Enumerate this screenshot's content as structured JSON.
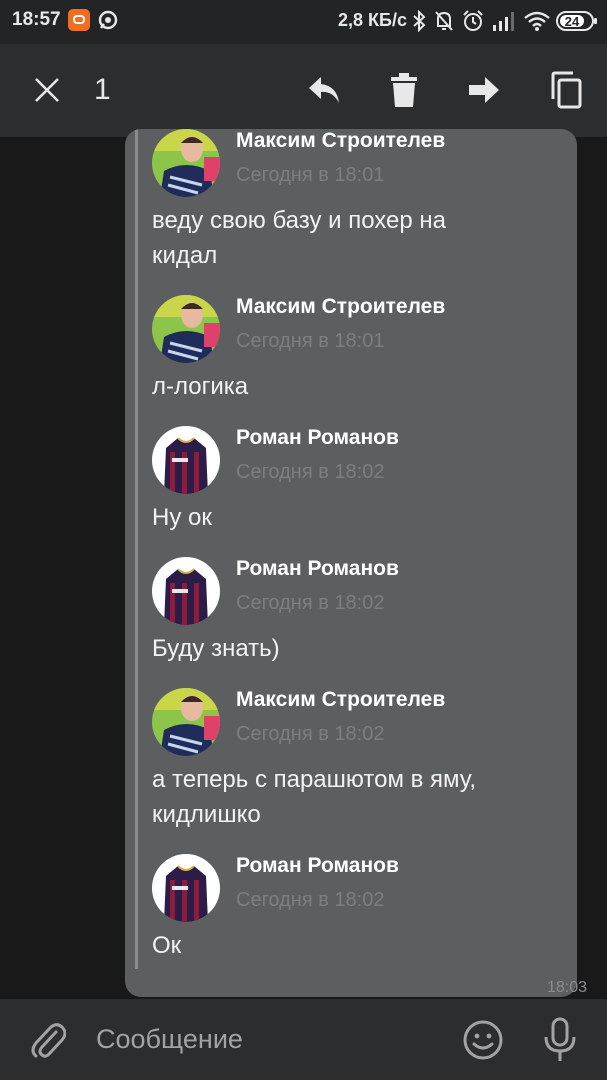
{
  "status_bar": {
    "time": "18:57",
    "net_speed": "2,8 КБ/с",
    "battery": "24"
  },
  "toolbar": {
    "selected_count": "1",
    "icons": [
      "close-icon",
      "reply-icon",
      "delete-icon",
      "forward-icon",
      "copy-icon"
    ]
  },
  "messages": [
    {
      "author": "Максим Строителев",
      "date": "Сегодня в 18:01",
      "lines": [
        "веду свою базу и похер на",
        "кидал"
      ],
      "avatar": "maxim"
    },
    {
      "author": "Максим Строителев",
      "date": "Сегодня в 18:01",
      "lines": [
        "л-логика"
      ],
      "avatar": "maxim"
    },
    {
      "author": "Роман Романов",
      "date": "Сегодня в 18:02",
      "lines": [
        "Ну ок"
      ],
      "avatar": "roman"
    },
    {
      "author": "Роман Романов",
      "date": "Сегодня в 18:02",
      "lines": [
        "Буду знать)"
      ],
      "avatar": "roman"
    },
    {
      "author": "Максим Строителев",
      "date": "Сегодня в 18:02",
      "lines": [
        "а теперь с парашютом в яму,",
        "кидлишко"
      ],
      "avatar": "maxim"
    },
    {
      "author": "Роман Романов",
      "date": "Сегодня в 18:02",
      "lines": [
        "Ок"
      ],
      "avatar": "roman"
    }
  ],
  "bubble_time": "18:03",
  "composer": {
    "placeholder": "Сообщение",
    "icons": [
      "attach-icon",
      "emoji-icon",
      "mic-icon"
    ]
  },
  "colors": {
    "toolbar": "#2c2d2e",
    "bubble": "#5d5e60",
    "background": "#19191a",
    "date_text": "#7d7e80",
    "battery": "#f26d21"
  }
}
